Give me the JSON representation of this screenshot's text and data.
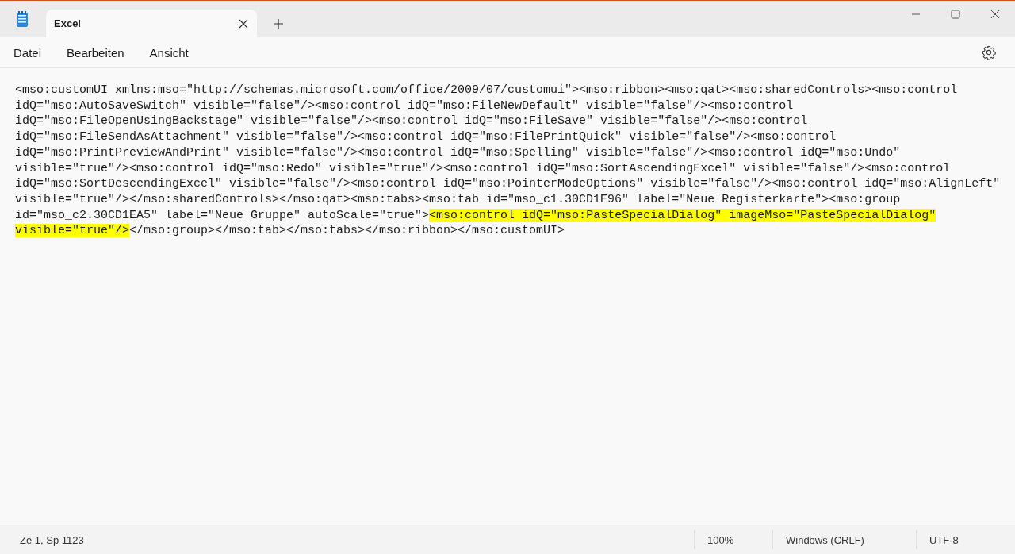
{
  "tab": {
    "title": "Excel"
  },
  "menu": [
    "Datei",
    "Bearbeiten",
    "Ansicht"
  ],
  "lines": [
    [
      {
        "text": "<mso:customUI xmlns:mso=\"http://schemas.microsoft.com/office/2009/07/customui\"><mso:ribbon><mso:qat><mso:sharedControls><mso:control",
        "highlighted": false
      }
    ],
    [
      {
        "text": "idQ=\"mso:AutoSaveSwitch\" visible=\"false\"/><mso:control idQ=\"mso:FileNewDefault\" visible=\"false\"/><mso:control",
        "highlighted": false
      }
    ],
    [
      {
        "text": "idQ=\"mso:FileOpenUsingBackstage\" visible=\"false\"/><mso:control idQ=\"mso:FileSave\" visible=\"false\"/><mso:control",
        "highlighted": false
      }
    ],
    [
      {
        "text": "idQ=\"mso:FileSendAsAttachment\" visible=\"false\"/><mso:control idQ=\"mso:FilePrintQuick\" visible=\"false\"/><mso:control",
        "highlighted": false
      }
    ],
    [
      {
        "text": "idQ=\"mso:PrintPreviewAndPrint\" visible=\"false\"/><mso:control idQ=\"mso:Spelling\" visible=\"false\"/><mso:control idQ=\"mso:Undo\"",
        "highlighted": false
      }
    ],
    [
      {
        "text": "visible=\"true\"/><mso:control idQ=\"mso:Redo\" visible=\"true\"/><mso:control idQ=\"mso:SortAscendingExcel\" visible=\"false\"/><mso:control",
        "highlighted": false
      }
    ],
    [
      {
        "text": "idQ=\"mso:SortDescendingExcel\" visible=\"false\"/><mso:control idQ=\"mso:PointerModeOptions\" visible=\"false\"/><mso:control idQ=\"mso:AlignLeft\"",
        "highlighted": false
      }
    ],
    [
      {
        "text": "visible=\"true\"/></mso:sharedControls></mso:qat><mso:tabs><mso:tab id=\"mso_c1.30CD1E96\" label=\"Neue Registerkarte\"><mso:group",
        "highlighted": false
      }
    ],
    [
      {
        "text": "id=\"mso_c2.30CD1EA5\" label=\"Neue Gruppe\" autoScale=\"true\">",
        "highlighted": false
      },
      {
        "text": "<mso:control idQ=\"mso:PasteSpecialDialog\" imageMso=\"PasteSpecialDialog\"",
        "highlighted": true
      }
    ],
    [
      {
        "text": "visible=\"true\"/>",
        "highlighted": true
      },
      {
        "text": "</mso:group></mso:tab></mso:tabs></mso:ribbon></mso:customUI>",
        "highlighted": false
      }
    ]
  ],
  "status_bar": {
    "position": "Ze 1, Sp 1123",
    "zoom": "100%",
    "line_ending": "Windows (CRLF)",
    "encoding": "UTF-8"
  }
}
